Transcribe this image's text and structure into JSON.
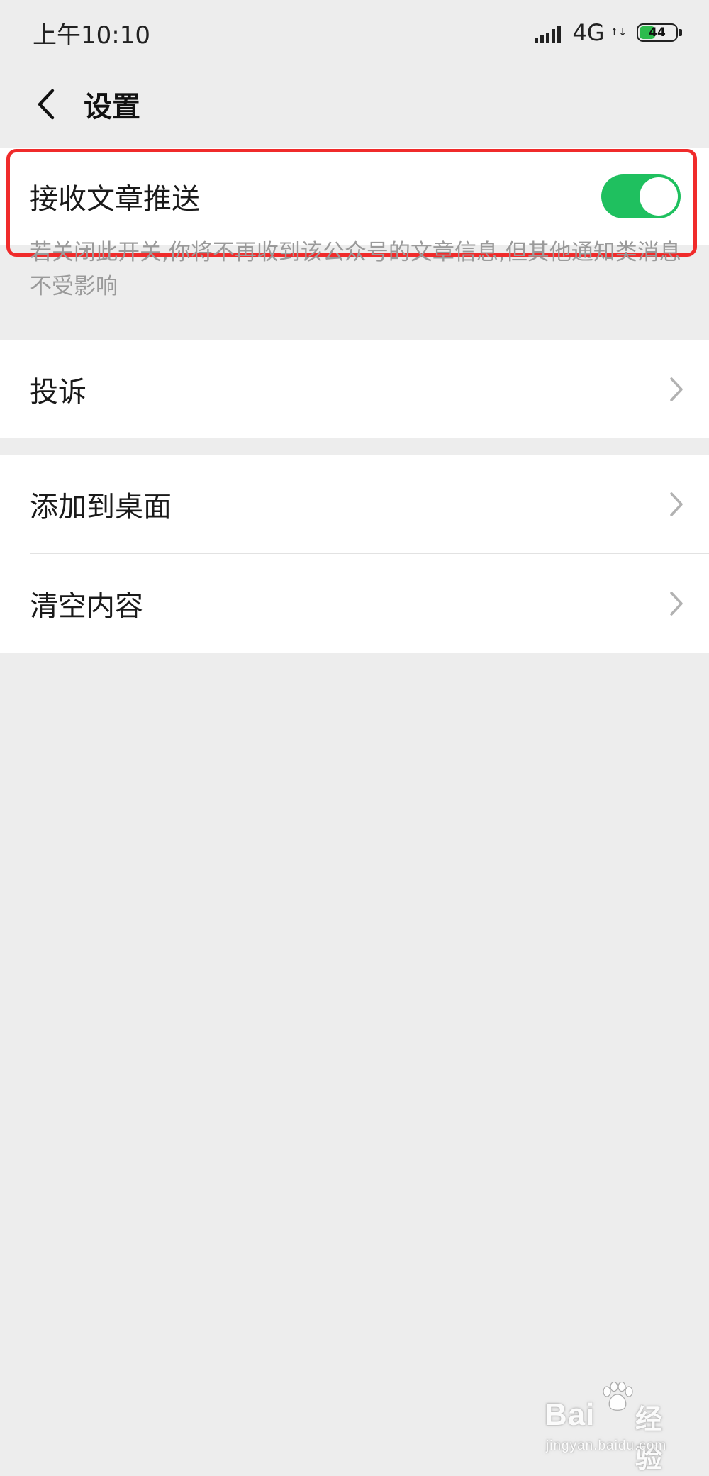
{
  "status_bar": {
    "time": "上午10:10",
    "network": "4G",
    "network_arrows": "↑↓",
    "battery_level": "44",
    "battery_fraction": 0.44,
    "battery_color": "#2dbb4c"
  },
  "nav": {
    "back_icon": "chevron-left-icon",
    "title": "设置"
  },
  "push_setting": {
    "label": "接收文章推送",
    "toggle_on": true,
    "toggle_color": "#1fc05f",
    "highlight_color": "#f02b2b",
    "hint": "若关闭此开关,你将不再收到该公众号的文章信息,但其他通知类消息不受影响"
  },
  "menu": {
    "complain": "投诉",
    "add_to_desktop": "添加到桌面",
    "clear_content": "清空内容"
  },
  "watermark": {
    "logo_left": "Bai",
    "logo_right": "经验",
    "url": "jingyan.baidu.com"
  }
}
